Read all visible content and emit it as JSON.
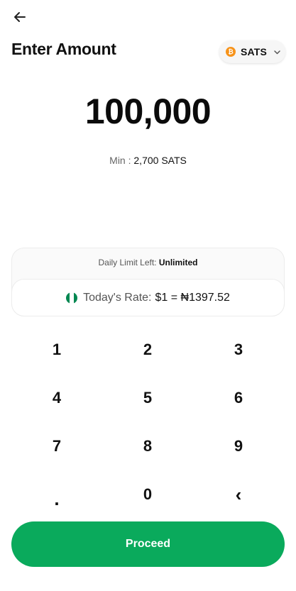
{
  "header": {
    "title": "Enter Amount",
    "back_icon": "arrow-left-icon"
  },
  "currency_selector": {
    "coin_symbol": "₿",
    "label": "SATS",
    "icon": "bitcoin-icon",
    "chevron": "chevron-down-icon",
    "coin_color": "#f7931a"
  },
  "amount": {
    "value": "100,000"
  },
  "minimum": {
    "label": "Min : ",
    "value": "2,700 SATS"
  },
  "info_card": {
    "daily_limit_label": "Daily Limit Left: ",
    "daily_limit_value": "Unlimited",
    "rate_label": "Today's Rate:",
    "rate_value": "$1 = ₦1397.52",
    "flag_icon": "nigeria-flag-icon"
  },
  "keypad": {
    "keys": [
      "1",
      "2",
      "3",
      "4",
      "5",
      "6",
      "7",
      "8",
      "9",
      ".",
      "0",
      "‹"
    ]
  },
  "actions": {
    "proceed_label": "Proceed"
  },
  "colors": {
    "accent": "#0aaa5c",
    "flag_green": "#008751"
  }
}
